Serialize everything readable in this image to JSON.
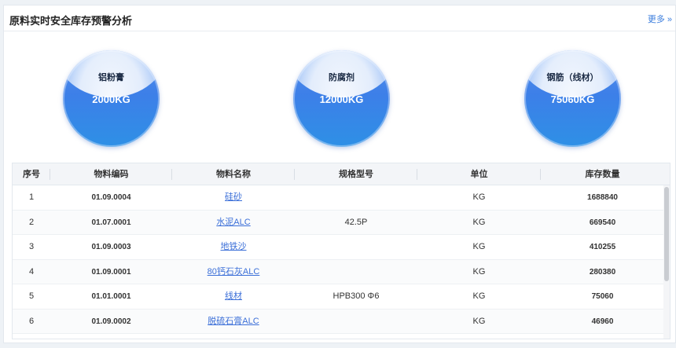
{
  "panel": {
    "title": "原料实时安全库存预警分析",
    "more_label": "更多",
    "more_icon": "double-chevron-right-icon"
  },
  "bubbles": [
    {
      "name": "铝粉膏",
      "value": "2000KG"
    },
    {
      "name": "防腐剂",
      "value": "12000KG"
    },
    {
      "name": "钢筋（线材）",
      "value": "75060KG"
    }
  ],
  "table": {
    "headers": [
      "序号",
      "物料编码",
      "物料名称",
      "规格型号",
      "单位",
      "库存数量"
    ],
    "rows": [
      {
        "idx": "1",
        "code": "01.09.0004",
        "name": "硅砂",
        "spec": "",
        "unit": "KG",
        "qty": "1688840"
      },
      {
        "idx": "2",
        "code": "01.07.0001",
        "name": "水泥ALC",
        "spec": "42.5P",
        "unit": "KG",
        "qty": "669540"
      },
      {
        "idx": "3",
        "code": "01.09.0003",
        "name": "地铁沙",
        "spec": "",
        "unit": "KG",
        "qty": "410255"
      },
      {
        "idx": "4",
        "code": "01.09.0001",
        "name": "80钙石灰ALC",
        "spec": "",
        "unit": "KG",
        "qty": "280380"
      },
      {
        "idx": "5",
        "code": "01.01.0001",
        "name": "线材",
        "spec": "HPB300 Φ6",
        "unit": "KG",
        "qty": "75060"
      },
      {
        "idx": "6",
        "code": "01.09.0002",
        "name": "脱硫石膏ALC",
        "spec": "",
        "unit": "KG",
        "qty": "46960"
      }
    ]
  }
}
